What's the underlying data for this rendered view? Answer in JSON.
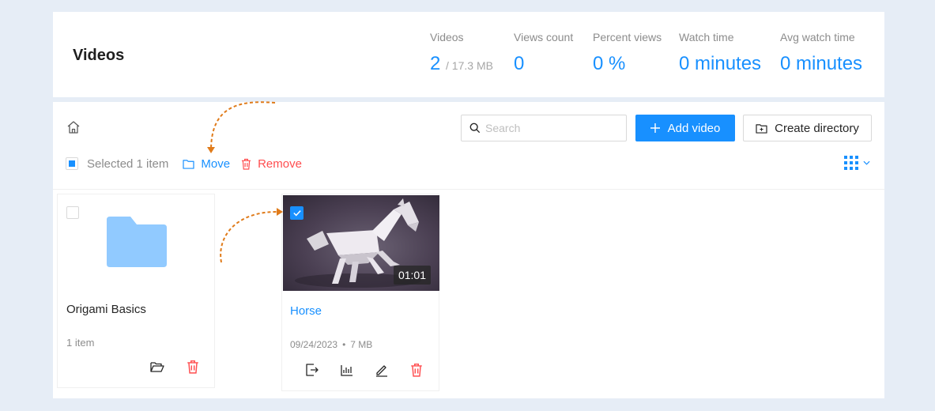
{
  "header": {
    "title": "Videos",
    "stats": [
      {
        "label": "Videos",
        "value": "2",
        "sub": "/ 17.3 MB"
      },
      {
        "label": "Views count",
        "value": "0"
      },
      {
        "label": "Percent views",
        "value": "0 %"
      },
      {
        "label": "Watch time",
        "value": "0 minutes"
      },
      {
        "label": "Avg watch time",
        "value": "0 minutes"
      }
    ]
  },
  "toolbar": {
    "search_placeholder": "Search",
    "add_video_label": "Add video",
    "create_directory_label": "Create directory",
    "selected_text": "Selected 1 item",
    "move_label": "Move",
    "remove_label": "Remove"
  },
  "items": [
    {
      "type": "folder",
      "name": "Origami Basics",
      "count": "1 item",
      "selected": false
    },
    {
      "type": "video",
      "title": "Horse",
      "duration": "01:01",
      "date": "09/24/2023",
      "size": "7 MB",
      "selected": true
    }
  ],
  "colors": {
    "accent": "#1890ff",
    "danger": "#ff4d4f",
    "folder": "#91caff",
    "annotation": "#e07b1a"
  }
}
